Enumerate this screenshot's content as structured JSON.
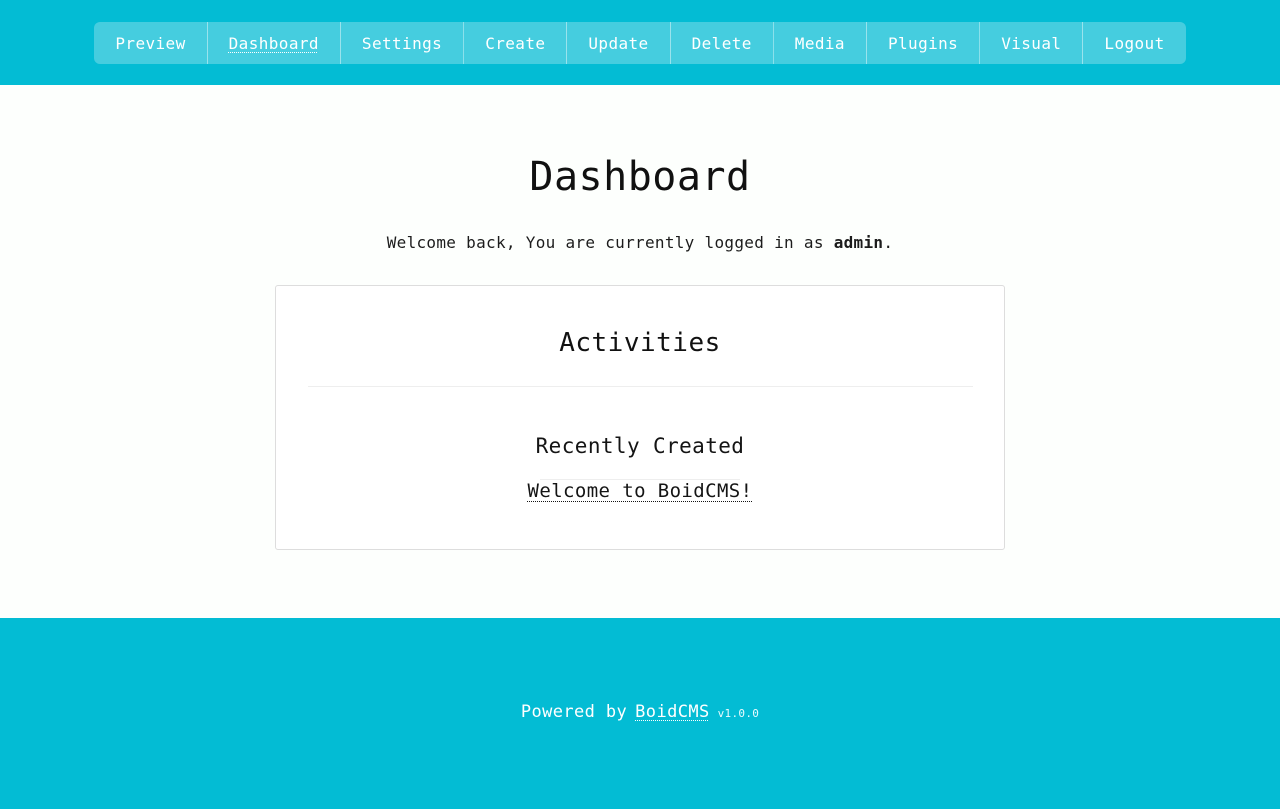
{
  "header": {
    "brand_color": "#03bcd4",
    "nav_groups": [
      {
        "items": [
          {
            "label": "Preview",
            "active": false,
            "name": "nav-item-preview"
          },
          {
            "label": "Dashboard",
            "active": true,
            "name": "nav-item-dashboard"
          },
          {
            "label": "Settings",
            "active": false,
            "name": "nav-item-settings"
          }
        ]
      },
      {
        "items": [
          {
            "label": "Create",
            "active": false,
            "name": "nav-item-create"
          },
          {
            "label": "Update",
            "active": false,
            "name": "nav-item-update"
          },
          {
            "label": "Delete",
            "active": false,
            "name": "nav-item-delete"
          }
        ]
      },
      {
        "items": [
          {
            "label": "Media",
            "active": false,
            "name": "nav-item-media"
          },
          {
            "label": "Plugins",
            "active": false,
            "name": "nav-item-plugins"
          }
        ]
      },
      {
        "items": [
          {
            "label": "Visual",
            "active": false,
            "name": "nav-item-visual"
          },
          {
            "label": "Logout",
            "active": false,
            "name": "nav-item-logout"
          }
        ]
      }
    ]
  },
  "main": {
    "title": "Dashboard",
    "welcome": {
      "prefix": "Welcome back, You are currently logged in as ",
      "username": "admin",
      "suffix": "."
    },
    "activities": {
      "title": "Activities",
      "recently_created": {
        "title": "Recently Created",
        "items": [
          {
            "label": "Welcome to BoidCMS!"
          }
        ]
      }
    }
  },
  "footer": {
    "powered_by": "Powered by",
    "brand": "BoidCMS",
    "version": "v1.0.0"
  }
}
